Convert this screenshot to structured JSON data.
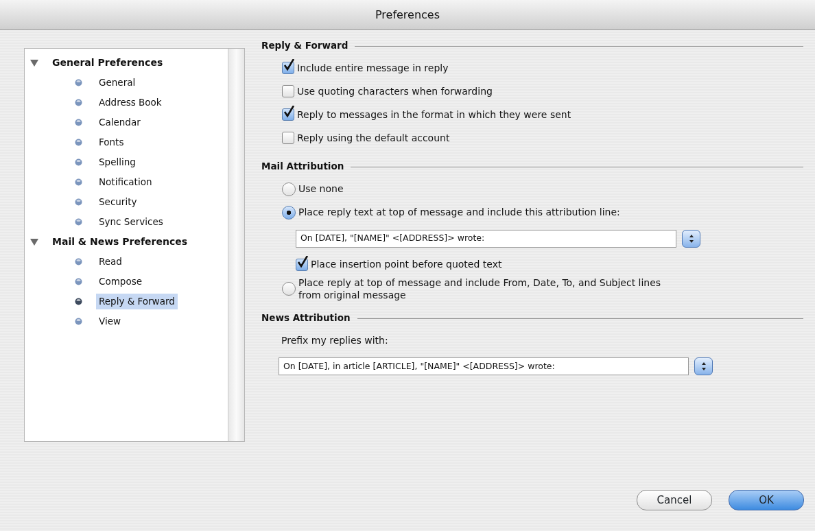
{
  "window": {
    "title": "Preferences"
  },
  "sidebar": {
    "groups": [
      {
        "label": "General Preferences",
        "expanded": true,
        "children": [
          {
            "label": "General",
            "selected": false
          },
          {
            "label": "Address Book",
            "selected": false
          },
          {
            "label": "Calendar",
            "selected": false
          },
          {
            "label": "Fonts",
            "selected": false
          },
          {
            "label": "Spelling",
            "selected": false
          },
          {
            "label": "Notification",
            "selected": false
          },
          {
            "label": "Security",
            "selected": false
          },
          {
            "label": "Sync Services",
            "selected": false
          }
        ]
      },
      {
        "label": "Mail & News Preferences",
        "expanded": true,
        "children": [
          {
            "label": "Read",
            "selected": false
          },
          {
            "label": "Compose",
            "selected": false
          },
          {
            "label": "Reply & Forward",
            "selected": true
          },
          {
            "label": "View",
            "selected": false
          }
        ]
      }
    ]
  },
  "sections": [
    {
      "title": "Reply & Forward",
      "items": [
        {
          "kind": "checkbox",
          "label": "Include entire message in reply",
          "checked": true
        },
        {
          "kind": "checkbox",
          "label": "Use quoting characters when forwarding",
          "checked": false
        },
        {
          "kind": "checkbox",
          "label": "Reply to messages in the format in which they were sent",
          "checked": true
        },
        {
          "kind": "checkbox",
          "label": "Reply using the default account",
          "checked": false
        }
      ]
    },
    {
      "title": "Mail Attribution",
      "items": [
        {
          "kind": "radio",
          "label": "Use none",
          "selected": false
        },
        {
          "kind": "radio",
          "label": "Place reply text at top of message and include this attribution line:",
          "selected": true,
          "children": [
            {
              "kind": "select",
              "value": "On [DATE], \"[NAME]\" <[ADDRESS]> wrote:"
            },
            {
              "kind": "checkbox",
              "label": "Place insertion point before quoted text",
              "checked": true
            }
          ]
        },
        {
          "kind": "radio",
          "label": "Place reply at top of message and include From, Date, To, and Subject lines from original message",
          "selected": false
        }
      ]
    },
    {
      "title": "News Attribution",
      "items": [
        {
          "kind": "label",
          "label": "Prefix my replies with:"
        },
        {
          "kind": "select",
          "value": "On [DATE], in article [ARTICLE], \"[NAME]\" <[ADDRESS]> wrote:"
        }
      ]
    }
  ],
  "buttons": [
    {
      "label": "Cancel",
      "default": false
    },
    {
      "label": "OK",
      "default": true
    }
  ]
}
